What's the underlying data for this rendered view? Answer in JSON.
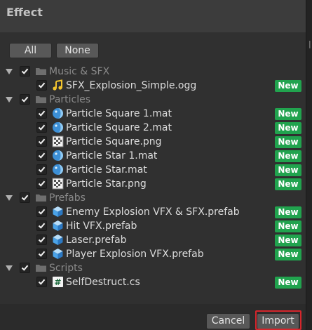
{
  "window": {
    "title": "Effect"
  },
  "toolbar": {
    "all_label": "All",
    "none_label": "None"
  },
  "tree": [
    {
      "type": "folder",
      "label": "Music & SFX",
      "checked": true
    },
    {
      "type": "file",
      "label": "SFX_Explosion_Simple.ogg",
      "icon": "audio-icon",
      "badge": "New",
      "checked": true
    },
    {
      "type": "folder",
      "label": "Particles",
      "checked": true
    },
    {
      "type": "file",
      "label": "Particle Square 1.mat",
      "icon": "material-icon",
      "badge": "New",
      "checked": true
    },
    {
      "type": "file",
      "label": "Particle Square 2.mat",
      "icon": "material-icon",
      "badge": "New",
      "checked": true
    },
    {
      "type": "file",
      "label": "Particle Square.png",
      "icon": "texture-icon",
      "badge": "New",
      "checked": true
    },
    {
      "type": "file",
      "label": "Particle Star 1.mat",
      "icon": "material-icon",
      "badge": "New",
      "checked": true
    },
    {
      "type": "file",
      "label": "Particle Star.mat",
      "icon": "material-icon",
      "badge": "New",
      "checked": true
    },
    {
      "type": "file",
      "label": "Particle Star.png",
      "icon": "texture-icon",
      "badge": "New",
      "checked": true
    },
    {
      "type": "folder",
      "label": "Prefabs",
      "checked": true
    },
    {
      "type": "file",
      "label": "Enemy Explosion VFX & SFX.prefab",
      "icon": "prefab-icon",
      "badge": "New",
      "checked": true
    },
    {
      "type": "file",
      "label": "Hit VFX.prefab",
      "icon": "prefab-icon",
      "badge": "New",
      "checked": true
    },
    {
      "type": "file",
      "label": "Laser.prefab",
      "icon": "prefab-icon",
      "badge": "New",
      "checked": true
    },
    {
      "type": "file",
      "label": "Player Explosion VFX.prefab",
      "icon": "prefab-icon",
      "badge": "New",
      "checked": true
    },
    {
      "type": "folder",
      "label": "Scripts",
      "checked": true
    },
    {
      "type": "file",
      "label": "SelfDestruct.cs",
      "icon": "csharp-script-icon",
      "badge": "New",
      "checked": true
    }
  ],
  "footer": {
    "cancel_label": "Cancel",
    "import_label": "Import"
  },
  "colors": {
    "new_badge": "#21a34e",
    "highlight": "#d6262c",
    "checkbox": "#242424"
  }
}
